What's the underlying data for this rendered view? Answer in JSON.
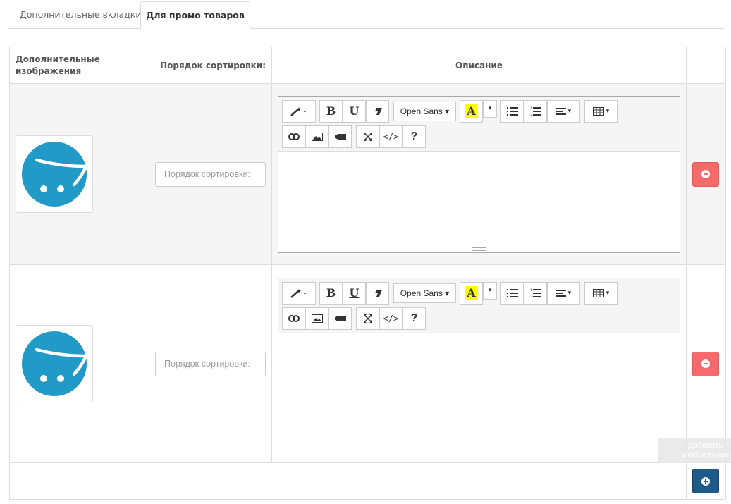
{
  "tabs": [
    {
      "label": "Дополнительные вкладки",
      "active": false
    },
    {
      "label": "Для промо товаров",
      "active": true
    }
  ],
  "table": {
    "headers": {
      "images": "Дополнительные изображения",
      "sort_order": "Порядок сортировки:",
      "description": "Описание"
    },
    "rows": [
      {
        "sort_placeholder": "Порядок сортировки:",
        "description": ""
      },
      {
        "sort_placeholder": "Порядок сортировки:",
        "description": ""
      }
    ]
  },
  "editor": {
    "font_label": "Open Sans",
    "bold": "B",
    "underline": "U",
    "highlight": "A",
    "code": "</>",
    "help": "?"
  },
  "tooltip": "Добавить изображение",
  "colors": {
    "logo": "#229ac8",
    "remove": "#f56b6b",
    "add": "#1e5a89",
    "highlight": "#ffff00"
  }
}
